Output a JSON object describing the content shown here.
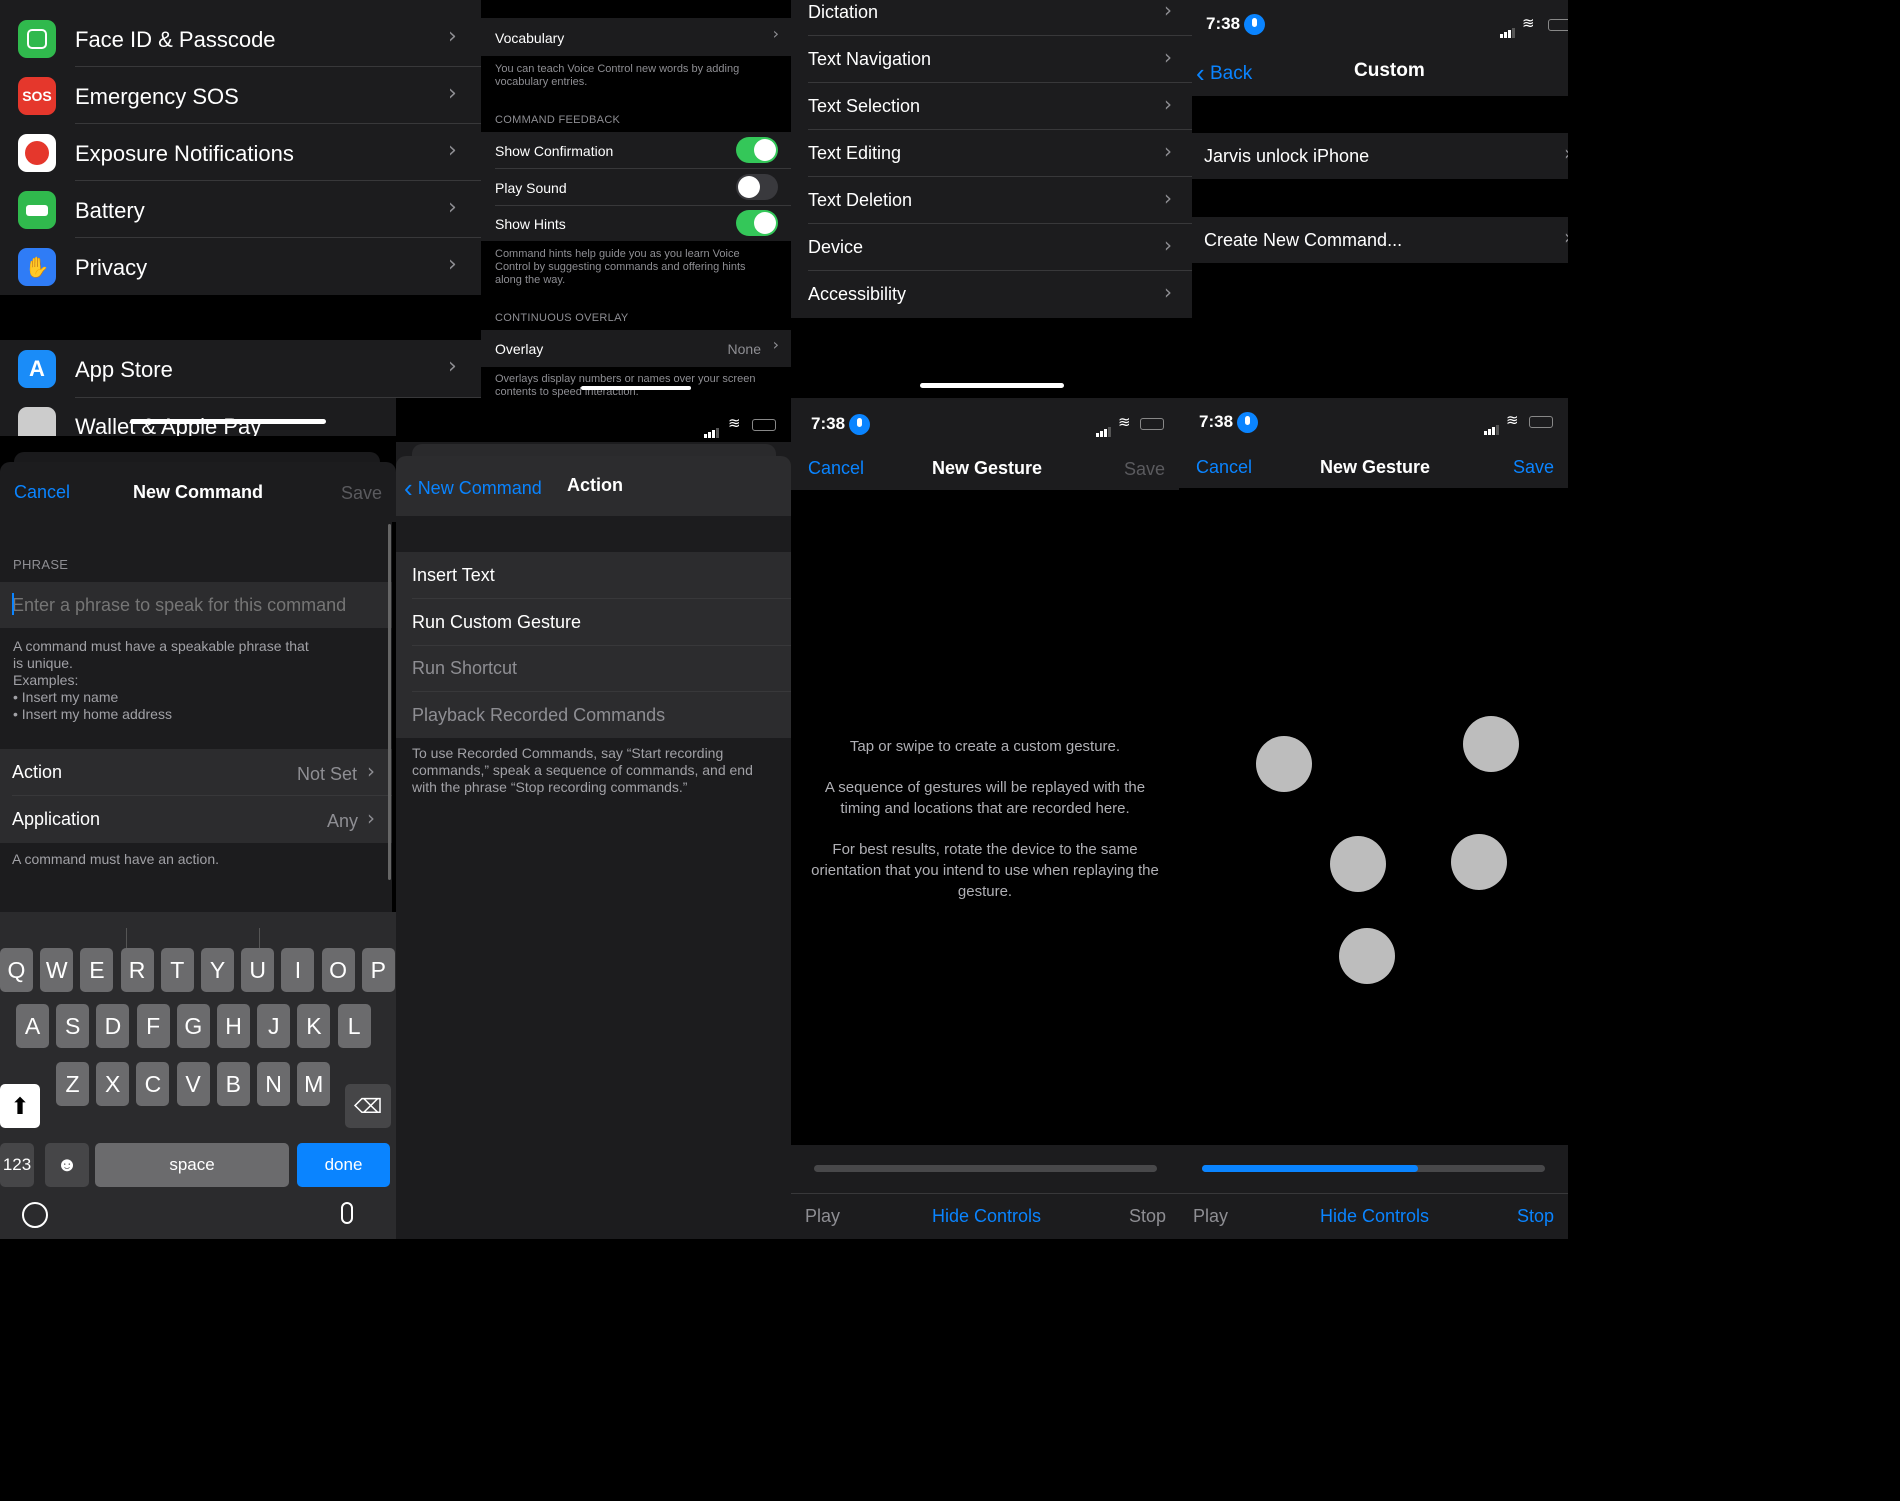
{
  "p1_settings": {
    "items_group1": [
      {
        "label": "Face ID & Passcode",
        "icon": "face-id-icon",
        "color": "#30b94d"
      },
      {
        "label": "Emergency SOS",
        "icon": "sos-icon",
        "color": "#e5372c"
      },
      {
        "label": "Exposure Notifications",
        "icon": "exposure-icon",
        "color": "#ffffff"
      },
      {
        "label": "Battery",
        "icon": "battery-icon",
        "color": "#30b94d"
      },
      {
        "label": "Privacy",
        "icon": "hand-icon",
        "color": "#2f7cf6"
      }
    ],
    "sos_text": "SOS",
    "items_group2": [
      {
        "label": "App Store",
        "icon": "app-store-icon",
        "color": "#1a8cf8"
      },
      {
        "label": "Wallet & Apple Pay",
        "icon": "wallet-icon",
        "color": "#cccccc"
      }
    ]
  },
  "p2_voice": {
    "vocabulary": "Vocabulary",
    "vocab_note": "You can teach Voice Control new words by adding vocabulary entries.",
    "feedback_header": "COMMAND FEEDBACK",
    "toggles": [
      {
        "label": "Show Confirmation",
        "on": true
      },
      {
        "label": "Play Sound",
        "on": false
      },
      {
        "label": "Show Hints",
        "on": true
      }
    ],
    "hints_note": "Command hints help guide you as you learn Voice Control by suggesting commands and offering hints along the way.",
    "overlay_header": "CONTINUOUS OVERLAY",
    "overlay_label": "Overlay",
    "overlay_value": "None",
    "overlay_note": "Overlays display numbers or names over your screen contents to speed interaction."
  },
  "p3_commands": {
    "items": [
      "Dictation",
      "Text Navigation",
      "Text Selection",
      "Text Editing",
      "Text Deletion",
      "Device",
      "Accessibility"
    ]
  },
  "p4_custom": {
    "time": "7:38",
    "back": "Back",
    "title": "Custom",
    "item1": "Jarvis unlock iPhone",
    "item2": "Create New Command..."
  },
  "p5_new_command": {
    "cancel": "Cancel",
    "title": "New Command",
    "save": "Save",
    "phrase_header": "PHRASE",
    "placeholder": "Enter a phrase to speak for this command",
    "phrase_note": [
      "A command must have a speakable phrase that",
      "is unique.",
      "Examples:",
      "• Insert my name",
      "• Insert my home address"
    ],
    "action_label": "Action",
    "action_value": "Not Set",
    "app_label": "Application",
    "app_value": "Any",
    "action_note": "A command must have an action.",
    "keys_row1": [
      "Q",
      "W",
      "E",
      "R",
      "T",
      "Y",
      "U",
      "I",
      "O",
      "P"
    ],
    "keys_row2": [
      "A",
      "S",
      "D",
      "F",
      "G",
      "H",
      "J",
      "K",
      "L"
    ],
    "keys_row3": [
      "Z",
      "X",
      "C",
      "V",
      "B",
      "N",
      "M"
    ],
    "key_123": "123",
    "key_space": "space",
    "key_done": "done"
  },
  "p6_action": {
    "back": "New Command",
    "title": "Action",
    "items": [
      {
        "label": "Insert Text",
        "enabled": true
      },
      {
        "label": "Run Custom Gesture",
        "enabled": true
      },
      {
        "label": "Run Shortcut",
        "enabled": false
      },
      {
        "label": "Playback Recorded Commands",
        "enabled": false
      }
    ],
    "note": "To use Recorded Commands, say “Start recording commands,” speak a sequence of commands, and end with the phrase “Stop recording commands.”"
  },
  "p7_gesture": {
    "time": "7:38",
    "cancel": "Cancel",
    "title": "New Gesture",
    "save": "Save",
    "instr1": "Tap or swipe to create a custom gesture.",
    "instr2": "A sequence of gestures will be replayed with the timing and locations that are recorded here.",
    "instr3": "For best results, rotate the device to the same orientation that you intend to use when replaying the gesture.",
    "play": "Play",
    "hide": "Hide Controls",
    "stop": "Stop",
    "progress": 0
  },
  "p8_gesture": {
    "time": "7:38",
    "cancel": "Cancel",
    "title": "New Gesture",
    "save": "Save",
    "play": "Play",
    "hide": "Hide Controls",
    "stop": "Stop",
    "progress": 0.63,
    "touch_points": 5
  }
}
